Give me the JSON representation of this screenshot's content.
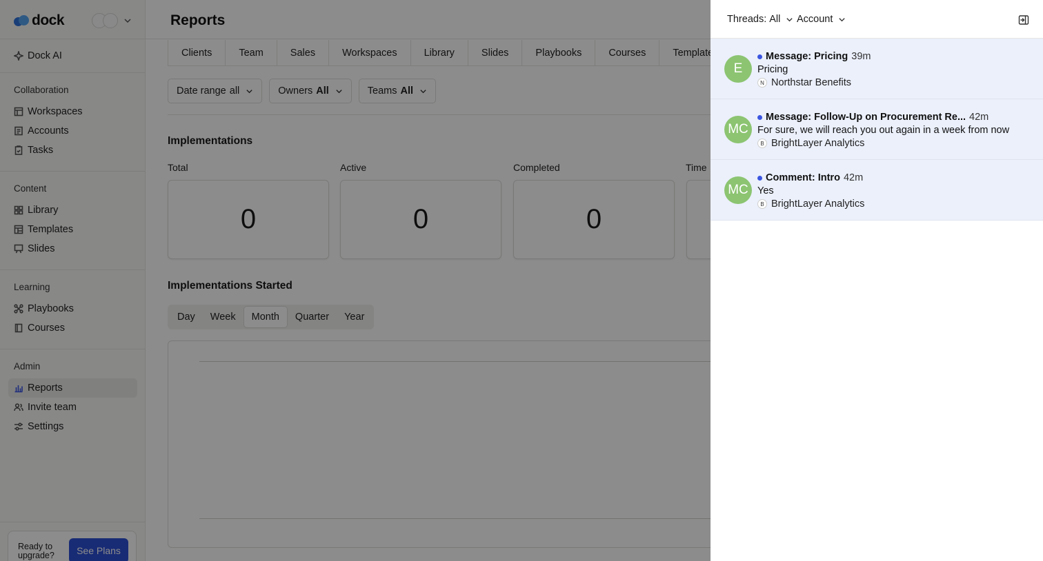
{
  "brand": {
    "name": "dock"
  },
  "sidebar": {
    "ai_label": "Dock AI",
    "sections": [
      {
        "title": "Collaboration",
        "items": [
          "Workspaces",
          "Accounts",
          "Tasks"
        ]
      },
      {
        "title": "Content",
        "items": [
          "Library",
          "Templates",
          "Slides"
        ]
      },
      {
        "title": "Learning",
        "items": [
          "Playbooks",
          "Courses"
        ]
      },
      {
        "title": "Admin",
        "items": [
          "Reports",
          "Invite team",
          "Settings"
        ]
      }
    ],
    "active_item": "Reports",
    "upgrade": {
      "text": "Ready to upgrade?",
      "button": "See Plans"
    }
  },
  "main": {
    "title": "Reports",
    "tabs": [
      "Clients",
      "Team",
      "Sales",
      "Workspaces",
      "Library",
      "Slides",
      "Playbooks",
      "Courses",
      "Templates"
    ],
    "filters": [
      {
        "label": "Date range",
        "value": "all"
      },
      {
        "label": "Owners",
        "value": "All"
      },
      {
        "label": "Teams",
        "value": "All"
      }
    ],
    "implementations": {
      "title": "Implementations",
      "stats": [
        {
          "label": "Total",
          "value": "0"
        },
        {
          "label": "Active",
          "value": "0"
        },
        {
          "label": "Completed",
          "value": "0"
        },
        {
          "label": "Time",
          "value": ""
        }
      ]
    },
    "started": {
      "title": "Implementations Started",
      "periods": [
        "Day",
        "Week",
        "Month",
        "Quarter",
        "Year"
      ],
      "active_period": "Month"
    }
  },
  "panel": {
    "threads_filter": {
      "label": "Threads:",
      "value": "All"
    },
    "account_filter": {
      "label": "Account"
    },
    "threads": [
      {
        "avatar": "E",
        "type": "Message: Pricing",
        "time": "39m",
        "body": "Pricing",
        "account_initial": "N",
        "account": "Northstar Benefits"
      },
      {
        "avatar": "MC",
        "type": "Message: Follow-Up on Procurement Re...",
        "time": "42m",
        "body": "For sure, we will reach you out again in a week from now",
        "account_initial": "B",
        "account": "BrightLayer Analytics"
      },
      {
        "avatar": "MC",
        "type": "Comment: Intro",
        "time": "42m",
        "body": "Yes",
        "account_initial": "B",
        "account": "BrightLayer Analytics"
      }
    ]
  },
  "colors": {
    "accent": "#2d4fd6",
    "unread_dot": "#3b55e0",
    "avatar_bg": "#8cc471",
    "thread_bg": "#ebf0fb"
  }
}
